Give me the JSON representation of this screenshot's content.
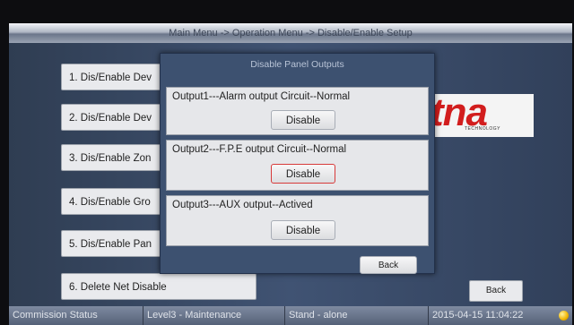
{
  "title": "Main Menu -> Operation Menu -> Disable/Enable Setup",
  "menu": [
    "1. Dis/Enable Dev",
    "2. Dis/Enable Dev",
    "3. Dis/Enable Zon",
    "4. Dis/Enable Gro",
    "5. Dis/Enable Pan",
    "6. Delete Net Disable"
  ],
  "logo": {
    "text": "tna",
    "subtext": "TECHNOLOGY"
  },
  "back_label": "Back",
  "dialog": {
    "title": "Disable Panel Outputs",
    "outputs": [
      {
        "label": "Output1---Alarm output Circuit--Normal",
        "button": "Disable"
      },
      {
        "label": "Output2---F.P.E output Circuit--Normal",
        "button": "Disable"
      },
      {
        "label": "Output3---AUX output--Actived",
        "button": "Disable"
      }
    ],
    "back_label": "Back"
  },
  "status": {
    "commission": "Commission Status",
    "level": "Level3 - Maintenance",
    "mode": "Stand - alone",
    "datetime": "2015-04-15 11:04:22"
  },
  "colors": {
    "selected_border": "#d83a3a",
    "logo_red": "#d21d1d",
    "status_led": "#f0b400"
  }
}
